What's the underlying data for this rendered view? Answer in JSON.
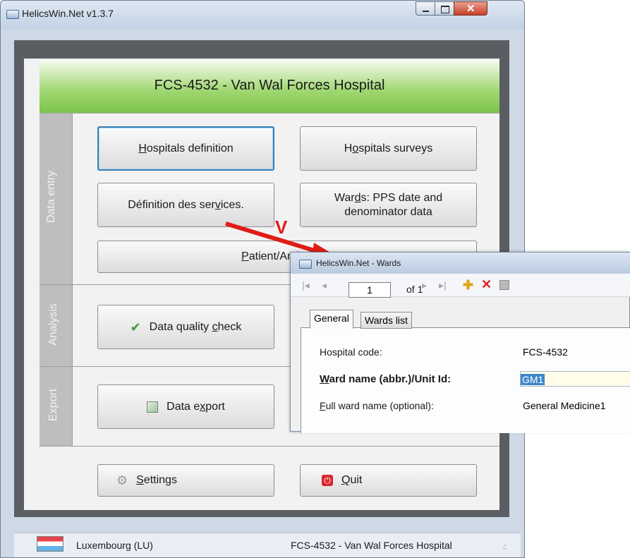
{
  "window": {
    "title": "HelicsWin.Net v1.3.7"
  },
  "header": {
    "hospital_title": "FCS-4532 - Van Wal Forces Hospital"
  },
  "sections": {
    "data_entry": "Data entry",
    "analysis": "Analysis",
    "export": "Export"
  },
  "buttons": {
    "hospitals_definition": {
      "pre": "",
      "key": "H",
      "post": "ospitals definition"
    },
    "hospitals_surveys": {
      "pre": "H",
      "key": "o",
      "post": "spitals surveys"
    },
    "services_definition": {
      "pre": "Définition des ser",
      "key": "v",
      "post": "ices."
    },
    "wards_line1": {
      "pre": "War",
      "key": "d",
      "post": "s: PPS date and"
    },
    "wards_line2": "denominator data",
    "patient": {
      "pre": "",
      "key": "P",
      "post": "atient/Antimicrob"
    },
    "data_quality": {
      "pre": "Data quality ",
      "key": "c",
      "post": "heck"
    },
    "data_export": {
      "pre": "Data e",
      "key": "x",
      "post": "port"
    },
    "settings": {
      "pre": "",
      "key": "S",
      "post": "ettings"
    },
    "quit": {
      "pre": "",
      "key": "Q",
      "post": "uit"
    }
  },
  "status_bar": {
    "country": "Luxembourg (LU)",
    "hospital": "FCS-4532 - Van Wal Forces Hospital"
  },
  "annotation": {
    "label": "V",
    "color": "#e11c16"
  },
  "wards_dialog": {
    "title": "HelicsWin.Net - Wards",
    "navigator": {
      "current_page": "1",
      "of_label": "of 1"
    },
    "tabs": [
      "General",
      "Wards list"
    ],
    "fields": {
      "hospital_code_label": "Hospital code:",
      "hospital_code_value": "FCS-4532",
      "ward_name_label": {
        "pre": "",
        "key": "W",
        "post": "ard name (abbr.)/Unit Id:"
      },
      "ward_name_value": "GM1",
      "full_name_label": {
        "pre": "",
        "key": "F",
        "post": "ull ward name (optional):"
      },
      "full_name_value": "General Medicine1"
    }
  },
  "colors": {
    "header_green": "#7cc44c",
    "focus_border": "#3c7fb1",
    "selection": "#3d86cc"
  },
  "icons": {
    "check": "checkmark-icon",
    "export": "export-icon",
    "settings": "gear-icon",
    "quit": "power-icon",
    "add": "add-icon",
    "delete": "delete-icon",
    "save": "save-icon"
  }
}
